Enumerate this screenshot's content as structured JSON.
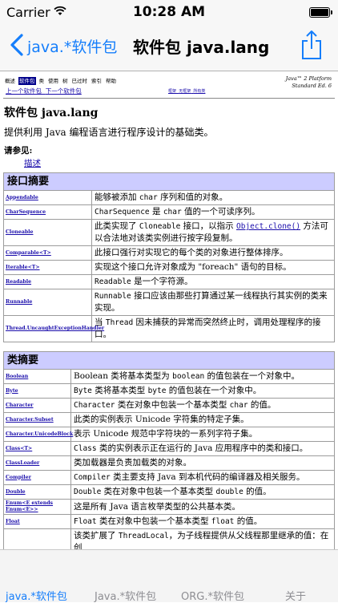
{
  "status": {
    "carrier": "Carrier",
    "time": "10:28 AM"
  },
  "nav": {
    "back_label": "java.*软件包",
    "title": "软件包 java.lang"
  },
  "doc": {
    "topnav": [
      "概述",
      "软件包",
      "类",
      "使用",
      "树",
      "已过时",
      "索引",
      "帮助"
    ],
    "topnav_active_index": 1,
    "prev_link": "上一个软件包",
    "next_link": "下一个软件包",
    "frame_links": [
      "框架",
      "无框架",
      "所有类"
    ],
    "platform_line1": "Java™ 2 Platform",
    "platform_line2": "Standard Ed. 6",
    "package_title": "软件包 java.lang",
    "package_desc": "提供利用 Java 编程语言进行程序设计的基础类。",
    "see_also_label": "请参见:",
    "see_also_link": "描述"
  },
  "interface_summary": {
    "header": "接口摘要",
    "rows": [
      {
        "name": "Appendable",
        "desc": [
          {
            "t": "能够被添加 "
          },
          {
            "t": "char",
            "code": true
          },
          {
            "t": " 序列和值的对象。"
          }
        ]
      },
      {
        "name": "CharSequence",
        "desc": [
          {
            "t": "CharSequence",
            "code": true
          },
          {
            "t": " 是 "
          },
          {
            "t": "char",
            "code": true
          },
          {
            "t": " 值的一个可读序列。"
          }
        ]
      },
      {
        "name": "Cloneable",
        "desc": [
          {
            "t": "此类实现了 "
          },
          {
            "t": "Cloneable",
            "code": true
          },
          {
            "t": " 接口，以指示 "
          },
          {
            "t": "Object.clone()",
            "link": true
          },
          {
            "t": " 方法可以合法地对该类实例进行按字段复制。"
          }
        ]
      },
      {
        "name": "Comparable<T>",
        "desc": [
          {
            "t": "此接口强行对实现它的每个类的对象进行整体排序。"
          }
        ]
      },
      {
        "name": "Iterable<T>",
        "desc": [
          {
            "t": "实现这个接口允许对象成为 \"foreach\" 语句的目标。"
          }
        ]
      },
      {
        "name": "Readable",
        "desc": [
          {
            "t": "Readable",
            "code": true
          },
          {
            "t": " 是一个字符源。"
          }
        ]
      },
      {
        "name": "Runnable",
        "desc": [
          {
            "t": "Runnable",
            "code": true
          },
          {
            "t": " 接口应该由那些打算通过某一线程执行其实例的类来实现。"
          }
        ]
      },
      {
        "name": "Thread.UncaughtExceptionHandler",
        "desc": [
          {
            "t": "当 "
          },
          {
            "t": "Thread",
            "code": true
          },
          {
            "t": " 因未捕获的异常而突然终止时，调用处理程序的接口。"
          }
        ]
      }
    ]
  },
  "class_summary": {
    "header": "类摘要",
    "rows": [
      {
        "name": "Boolean",
        "desc": [
          {
            "t": "Boolean 类将基本类型为 "
          },
          {
            "t": "boolean",
            "code": true
          },
          {
            "t": " 的值包装在一个对象中。"
          }
        ]
      },
      {
        "name": "Byte",
        "desc": [
          {
            "t": "Byte",
            "code": true
          },
          {
            "t": " 类将基本类型 "
          },
          {
            "t": "byte",
            "code": true
          },
          {
            "t": " 的值包装在一个对象中。"
          }
        ]
      },
      {
        "name": "Character",
        "desc": [
          {
            "t": "Character",
            "code": true
          },
          {
            "t": " 类在对象中包装一个基本类型 "
          },
          {
            "t": "char",
            "code": true
          },
          {
            "t": " 的值。"
          }
        ]
      },
      {
        "name": "Character.Subset",
        "desc": [
          {
            "t": "此类的实例表示 Unicode 字符集的特定子集。"
          }
        ]
      },
      {
        "name": "Character.UnicodeBlock",
        "desc": [
          {
            "t": "表示 Unicode 规范中字符块的一系列字符子集。"
          }
        ]
      },
      {
        "name": "Class<T>",
        "desc": [
          {
            "t": "Class",
            "code": true
          },
          {
            "t": " 类的实例表示正在运行的 Java 应用程序中的类和接口。"
          }
        ]
      },
      {
        "name": "ClassLoader",
        "desc": [
          {
            "t": "类加载器是负责加载类的对象。"
          }
        ]
      },
      {
        "name": "Compiler",
        "desc": [
          {
            "t": "Compiler",
            "code": true
          },
          {
            "t": " 类主要支持 Java 到本机代码的编译器及相关服务。"
          }
        ]
      },
      {
        "name": "Double",
        "desc": [
          {
            "t": "Double",
            "code": true
          },
          {
            "t": " 类在对象中包装一个基本类型 "
          },
          {
            "t": "double",
            "code": true
          },
          {
            "t": " 的值。"
          }
        ]
      },
      {
        "name": "Enum<E extends Enum<E>>",
        "desc": [
          {
            "t": "这是所有 Java 语言枚举类型的公共基本类。"
          }
        ]
      },
      {
        "name": "Float",
        "desc": [
          {
            "t": "Float",
            "code": true
          },
          {
            "t": " 类在对象中包装一个基本类型 "
          },
          {
            "t": "float",
            "code": true
          },
          {
            "t": " 的值。"
          }
        ]
      },
      {
        "name": "",
        "desc": [
          {
            "t": "该类扩展了 "
          },
          {
            "t": "ThreadLocal",
            "code": true
          },
          {
            "t": "，为子线程提供从父线程那里继承的值：在创"
          }
        ]
      }
    ]
  },
  "tabs": [
    {
      "label": "java.*软件包",
      "selected": true
    },
    {
      "label": "Java.*软件包",
      "selected": false
    },
    {
      "label": "ORG.*软件包",
      "selected": false
    },
    {
      "label": "关于",
      "selected": false
    }
  ]
}
